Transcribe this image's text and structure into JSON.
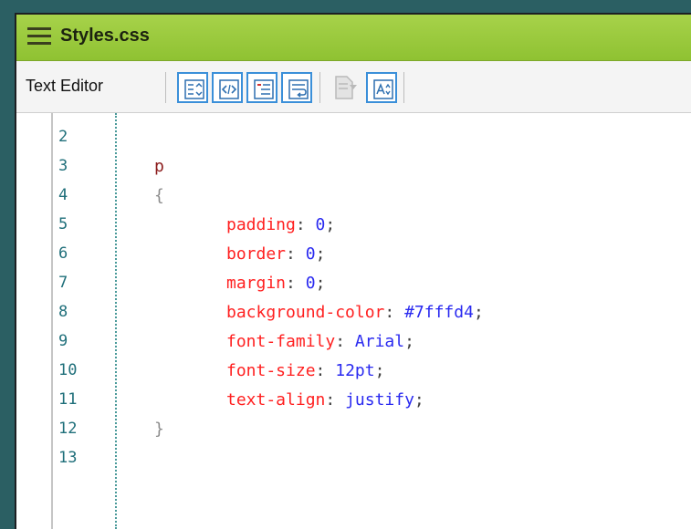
{
  "window": {
    "title": "Styles.css",
    "titlebar_color": "#9ccb3d"
  },
  "toolbar": {
    "label": "Text Editor",
    "buttons": [
      {
        "icon": "format-list-icon",
        "state": "active"
      },
      {
        "icon": "code-tags-icon",
        "state": "active"
      },
      {
        "icon": "outline-list-icon",
        "state": "active"
      },
      {
        "icon": "word-wrap-icon",
        "state": "active"
      },
      {
        "icon": "document-insert-icon",
        "state": "disabled"
      },
      {
        "icon": "font-size-icon",
        "state": "active"
      }
    ]
  },
  "editor": {
    "lines": [
      {
        "num": "2",
        "selector": "",
        "brace": "",
        "prop": "",
        "colon": "",
        "value": "",
        "semi": ""
      },
      {
        "num": "3",
        "selector": "p",
        "brace": "",
        "prop": "",
        "colon": "",
        "value": "",
        "semi": ""
      },
      {
        "num": "4",
        "selector": "",
        "brace": "{",
        "prop": "",
        "colon": "",
        "value": "",
        "semi": ""
      },
      {
        "num": "5",
        "selector": "",
        "brace": "",
        "prop": "padding",
        "colon": ":",
        "value": "0",
        "semi": ";"
      },
      {
        "num": "6",
        "selector": "",
        "brace": "",
        "prop": "border",
        "colon": ":",
        "value": "0",
        "semi": ";"
      },
      {
        "num": "7",
        "selector": "",
        "brace": "",
        "prop": "margin",
        "colon": ":",
        "value": "0",
        "semi": ";"
      },
      {
        "num": "8",
        "selector": "",
        "brace": "",
        "prop": "background-color",
        "colon": ":",
        "value": "#7fffd4",
        "semi": ";"
      },
      {
        "num": "9",
        "selector": "",
        "brace": "",
        "prop": "font-family",
        "colon": ":",
        "value": "Arial",
        "semi": ";"
      },
      {
        "num": "10",
        "selector": "",
        "brace": "",
        "prop": "font-size",
        "colon": ":",
        "value": "12pt",
        "semi": ";"
      },
      {
        "num": "11",
        "selector": "",
        "brace": "",
        "prop": "text-align",
        "colon": ":",
        "value": "justify",
        "semi": ";"
      },
      {
        "num": "12",
        "selector": "",
        "brace": "}",
        "prop": "",
        "colon": "",
        "value": "",
        "semi": ""
      },
      {
        "num": "13",
        "selector": "",
        "brace": "",
        "prop": "",
        "colon": "",
        "value": "",
        "semi": ""
      }
    ]
  }
}
